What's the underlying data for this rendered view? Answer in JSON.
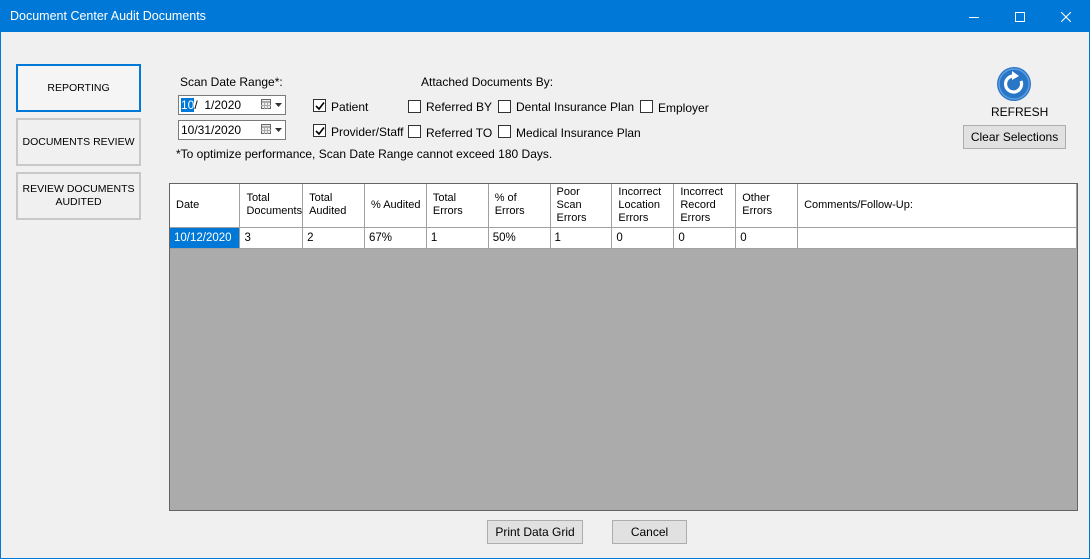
{
  "window": {
    "title": "Document Center Audit Documents"
  },
  "nav": [
    {
      "label": "REPORTING",
      "active": true
    },
    {
      "label": "DOCUMENTS REVIEW",
      "active": false
    },
    {
      "label": "REVIEW DOCUMENTS\nAUDITED",
      "active": false
    }
  ],
  "scan_range": {
    "label": "Scan Date Range*:",
    "start_month": "10",
    "start_rest": "/  1/2020",
    "end_date": "10/31/2020",
    "note": "*To optimize performance, Scan Date Range cannot exceed 180 Days."
  },
  "checkboxes": {
    "patient": {
      "label": "Patient",
      "checked": true
    },
    "provider_staff": {
      "label": "Provider/Staff",
      "checked": true
    }
  },
  "attached": {
    "label": "Attached Documents By:",
    "referred_by": {
      "label": "Referred BY",
      "checked": false
    },
    "referred_to": {
      "label": "Referred TO",
      "checked": false
    },
    "dental": {
      "label": "Dental Insurance Plan",
      "checked": false
    },
    "medical": {
      "label": "Medical Insurance Plan",
      "checked": false
    },
    "employer": {
      "label": "Employer",
      "checked": false
    }
  },
  "refresh": {
    "label": "REFRESH"
  },
  "clear": {
    "label": "Clear Selections"
  },
  "grid": {
    "columns": [
      "Date",
      "Total\nDocuments",
      "Total\nAudited",
      "% Audited",
      "Total\nErrors",
      "% of\nErrors",
      "Poor\nScan\nErrors",
      "Incorrect\nLocation\nErrors",
      "Incorrect\nRecord\nErrors",
      "Other\nErrors",
      "Comments/Follow-Up:"
    ],
    "rows": [
      [
        "10/12/2020",
        "3",
        "2",
        "67%",
        "1",
        "50%",
        "1",
        "0",
        "0",
        "0",
        ""
      ]
    ]
  },
  "footer": {
    "print": "Print Data Grid",
    "cancel": "Cancel"
  },
  "colors": {
    "accent": "#0078d7",
    "grid_bg": "#ababab",
    "refresh_icon": "#2a76c6"
  }
}
